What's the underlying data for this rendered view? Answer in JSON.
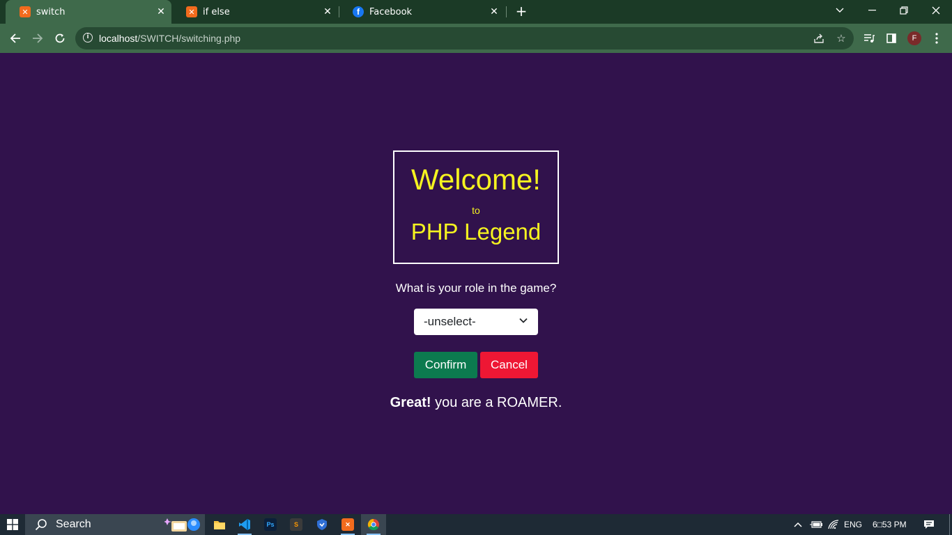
{
  "browser": {
    "tabs": [
      {
        "title": "switch",
        "icon": "xampp-icon",
        "active": true
      },
      {
        "title": "if else",
        "icon": "xampp-icon",
        "active": false
      },
      {
        "title": "Facebook",
        "icon": "facebook-icon",
        "active": false
      }
    ],
    "address": {
      "host": "localhost",
      "path": "/SWITCH/switching.php"
    },
    "profile_initial": "F"
  },
  "page": {
    "welcome": {
      "line1": "Welcome!",
      "line2": "to",
      "line3": "PHP Legend"
    },
    "question": "What is your role in the game?",
    "role_select": {
      "selected": "-unselect-"
    },
    "buttons": {
      "confirm": "Confirm",
      "cancel": "Cancel"
    },
    "result": {
      "emphasis": "Great!",
      "text": " you are a ROAMER."
    }
  },
  "taskbar": {
    "search_label": "Search",
    "language": "ENG",
    "time": "6□53 PM"
  },
  "colors": {
    "page_background": "#31124c",
    "title_yellow": "#f5f320",
    "confirm_green": "#0c7a4f",
    "cancel_red": "#ee1734",
    "browser_frame": "#3f6a4b"
  }
}
